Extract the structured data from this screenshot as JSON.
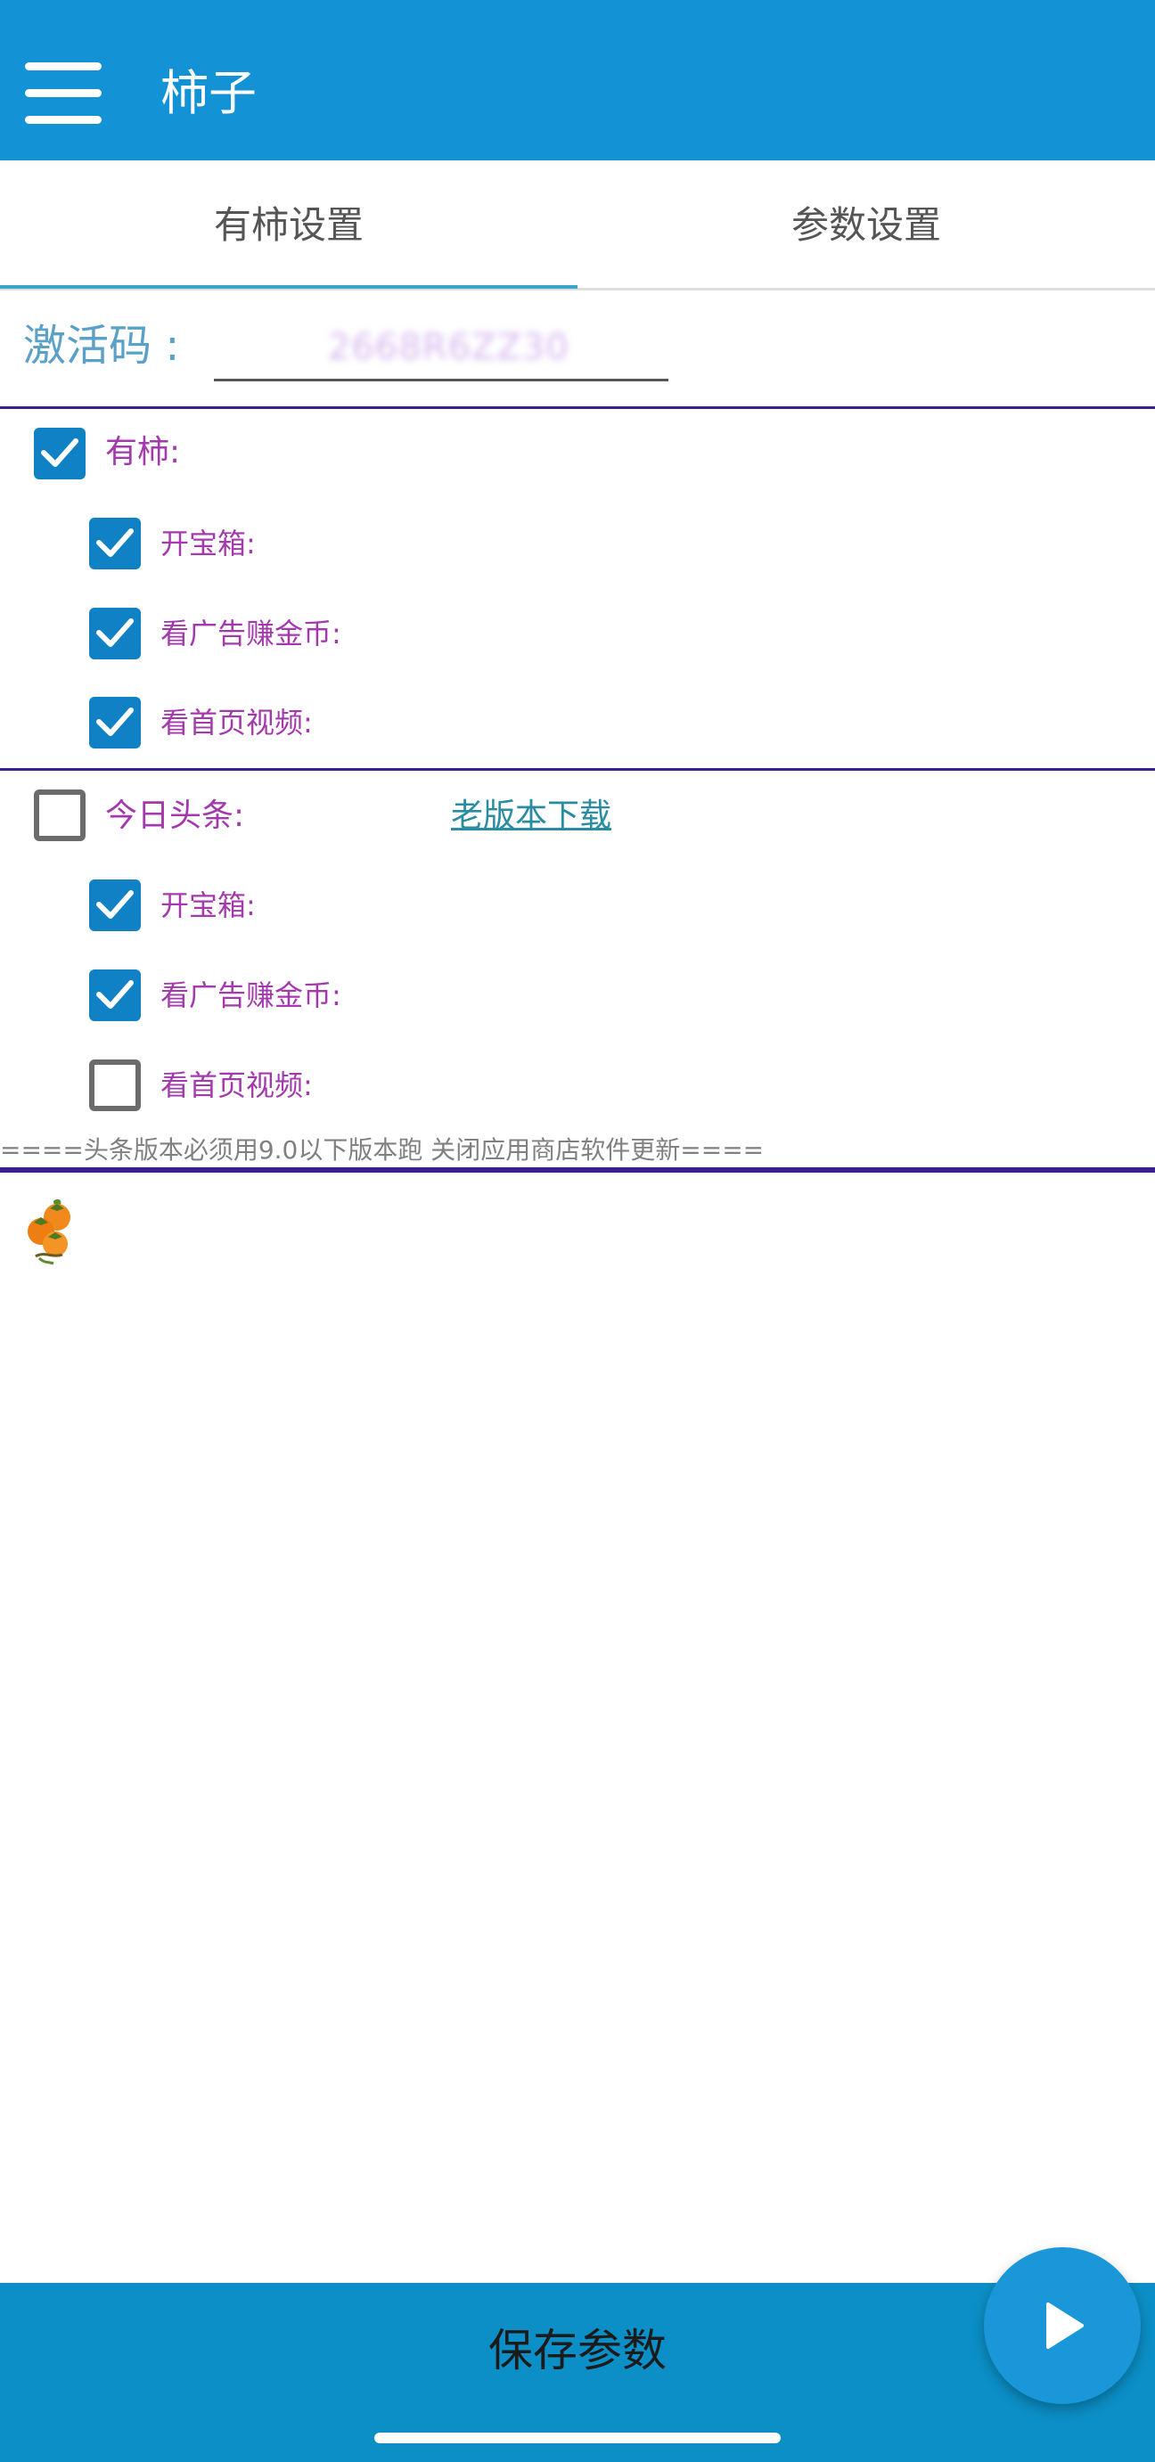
{
  "app": {
    "title": "柿子"
  },
  "tabs": [
    {
      "label": "有柿设置",
      "selected": true
    },
    {
      "label": "参数设置",
      "selected": false
    }
  ],
  "activation": {
    "label": "激活码 :",
    "value": "2668R6ZZ30"
  },
  "section_youshi": {
    "label": "有柿:",
    "checked": true,
    "options": [
      {
        "label": "开宝箱:",
        "checked": true
      },
      {
        "label": "看广告赚金币:",
        "checked": true
      },
      {
        "label": "看首页视频:",
        "checked": true
      }
    ]
  },
  "section_toutiao": {
    "label": "今日头条:",
    "checked": false,
    "link": "老版本下载",
    "options": [
      {
        "label": "开宝箱:",
        "checked": true
      },
      {
        "label": "看广告赚金币:",
        "checked": true
      },
      {
        "label": "看首页视频:",
        "checked": false
      }
    ]
  },
  "note": "====头条版本必须用9.0以下版本跑 关闭应用商店软件更新====",
  "footer": {
    "save_label": "保存参数"
  },
  "icons": {
    "menu": "menu-icon",
    "check": "check-icon",
    "fruit": "persimmon-icon",
    "play": "play-icon"
  },
  "colors": {
    "primary": "#1393d6",
    "checkbox": "#1081c5",
    "option_text": "#a438ad",
    "divider": "#3a1f8f",
    "link": "#2a8ca0"
  }
}
